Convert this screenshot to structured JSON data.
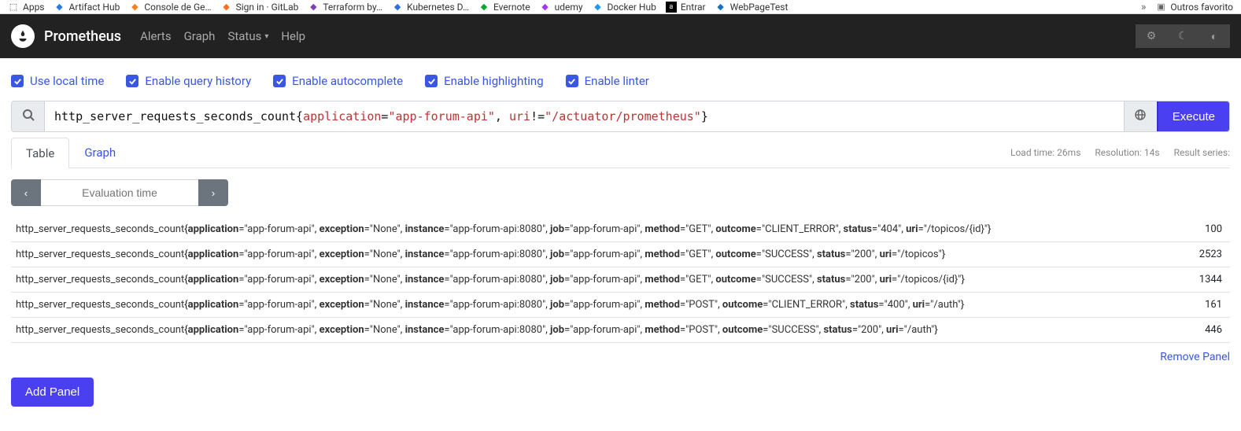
{
  "bookmarks": {
    "items": [
      {
        "label": "Apps"
      },
      {
        "label": "Artifact Hub"
      },
      {
        "label": "Console de Ge…"
      },
      {
        "label": "Sign in · GitLab"
      },
      {
        "label": "Terraform by…"
      },
      {
        "label": "Kubernetes D…"
      },
      {
        "label": "Evernote"
      },
      {
        "label": "udemy"
      },
      {
        "label": "Docker Hub"
      },
      {
        "label": "Entrar"
      },
      {
        "label": "WebPageTest"
      }
    ],
    "other": "Outros favorito"
  },
  "nav": {
    "brand": "Prometheus",
    "links": [
      "Alerts",
      "Graph",
      "Status",
      "Help"
    ]
  },
  "options": [
    {
      "label": "Use local time",
      "checked": true
    },
    {
      "label": "Enable query history",
      "checked": true
    },
    {
      "label": "Enable autocomplete",
      "checked": true
    },
    {
      "label": "Enable highlighting",
      "checked": true
    },
    {
      "label": "Enable linter",
      "checked": true
    }
  ],
  "query": {
    "metric": "http_server_requests_seconds_count",
    "label1_key": "application",
    "label1_op": "=",
    "label1_val": "\"app-forum-api\"",
    "sep": ", ",
    "label2_key": "uri",
    "label2_op": "!=",
    "label2_val": "\"/actuator/prometheus\"",
    "open": "{",
    "close": "}"
  },
  "execute_label": "Execute",
  "tabs": {
    "table": "Table",
    "graph": "Graph"
  },
  "stats": {
    "load": "Load time: 26ms",
    "res": "Resolution: 14s",
    "series": "Result series:"
  },
  "eval_placeholder": "Evaluation time",
  "results": [
    {
      "metric": "http_server_requests_seconds_count",
      "labels": {
        "application": "app-forum-api",
        "exception": "None",
        "instance": "app-forum-api:8080",
        "job": "app-forum-api",
        "method": "GET",
        "outcome": "CLIENT_ERROR",
        "status": "404",
        "uri": "/topicos/{id}"
      },
      "value": "100"
    },
    {
      "metric": "http_server_requests_seconds_count",
      "labels": {
        "application": "app-forum-api",
        "exception": "None",
        "instance": "app-forum-api:8080",
        "job": "app-forum-api",
        "method": "GET",
        "outcome": "SUCCESS",
        "status": "200",
        "uri": "/topicos"
      },
      "value": "2523"
    },
    {
      "metric": "http_server_requests_seconds_count",
      "labels": {
        "application": "app-forum-api",
        "exception": "None",
        "instance": "app-forum-api:8080",
        "job": "app-forum-api",
        "method": "GET",
        "outcome": "SUCCESS",
        "status": "200",
        "uri": "/topicos/{id}"
      },
      "value": "1344"
    },
    {
      "metric": "http_server_requests_seconds_count",
      "labels": {
        "application": "app-forum-api",
        "exception": "None",
        "instance": "app-forum-api:8080",
        "job": "app-forum-api",
        "method": "POST",
        "outcome": "CLIENT_ERROR",
        "status": "400",
        "uri": "/auth"
      },
      "value": "161"
    },
    {
      "metric": "http_server_requests_seconds_count",
      "labels": {
        "application": "app-forum-api",
        "exception": "None",
        "instance": "app-forum-api:8080",
        "job": "app-forum-api",
        "method": "POST",
        "outcome": "SUCCESS",
        "status": "200",
        "uri": "/auth"
      },
      "value": "446"
    }
  ],
  "remove_label": "Remove Panel",
  "add_label": "Add Panel"
}
